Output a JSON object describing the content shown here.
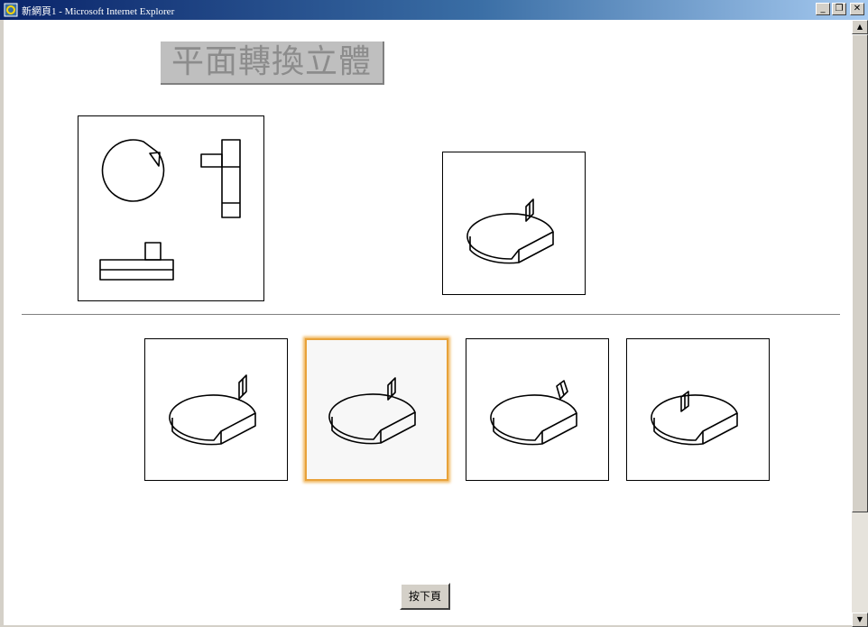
{
  "window": {
    "title": "新網頁1 - Microsoft Internet Explorer",
    "minimize_glyph": "_",
    "maximize_glyph": "❐",
    "close_glyph": "✕",
    "icon": "ie-icon"
  },
  "page": {
    "title": "平面轉換立體",
    "next_button_label": "按下頁"
  },
  "question": {
    "orthographic_views": [
      "top-view",
      "front-view",
      "side-view"
    ],
    "answer_preview": "isometric-cylinder-with-fin"
  },
  "options": [
    {
      "name": "option-1",
      "selected": false
    },
    {
      "name": "option-2",
      "selected": true
    },
    {
      "name": "option-3",
      "selected": false
    },
    {
      "name": "option-4",
      "selected": false
    }
  ],
  "scrollbar": {
    "up_arrow": "▲",
    "down_arrow": "▼"
  },
  "colors": {
    "titlebar_start": "#0a246a",
    "titlebar_end": "#a6caf0",
    "selection_highlight": "#e8a23a",
    "title_box_bg": "#bfbfbf"
  }
}
